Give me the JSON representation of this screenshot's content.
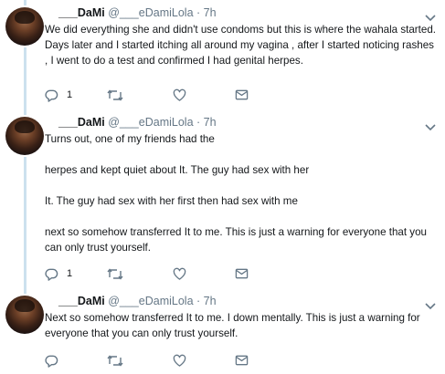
{
  "colors": {
    "thread_line": "#cce1ee",
    "icon_gray": "#657786",
    "text": "#14171a"
  },
  "tweets": [
    {
      "name": "___DaMi",
      "handle": "@___eDamiLola",
      "time": "· 7h",
      "lines": [
        "We did everything she and didn't use condoms but this is where the wahala started. Days later and I started itching all around my vagina , after I started noticing rashes , I went to do a test and confirmed I had genital herpes."
      ],
      "reply_count": "1",
      "icons": [
        "reply-icon",
        "retweet-icon",
        "heart-icon",
        "message-icon"
      ]
    },
    {
      "name": "___DaMi",
      "handle": "@___eDamiLola",
      "time": "· 7h",
      "lines": [
        "Turns out, one of my friends had the",
        "herpes and kept quiet about It. The guy had sex with her",
        "It. The guy had sex with her first then had sex with me",
        "next so somehow transferred It to me. This is just a warning for everyone that you can only trust yourself."
      ],
      "reply_count": "1",
      "icons": [
        "reply-icon",
        "retweet-icon",
        "heart-icon",
        "message-icon"
      ]
    },
    {
      "name": "___DaMi",
      "handle": "@___eDamiLola",
      "time": "· 7h",
      "lines": [
        "Next so somehow transferred It to me. I down mentally.  This is just a warning for everyone that you can only trust yourself."
      ],
      "reply_count": "",
      "icons": [
        "reply-icon",
        "retweet-icon",
        "heart-icon",
        "message-icon"
      ]
    }
  ]
}
